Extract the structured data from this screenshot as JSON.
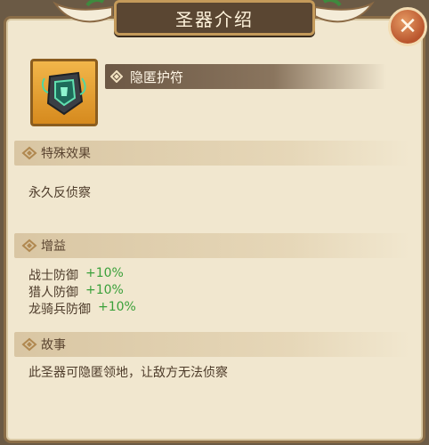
{
  "header": {
    "title": "圣器介绍",
    "close_glyph": "✕"
  },
  "artifact": {
    "name": "隐匿护符",
    "icon": "amulet-icon"
  },
  "sections": {
    "effect": {
      "title": "特殊效果",
      "text": "永久反侦察"
    },
    "buff": {
      "title": "增益",
      "rows": [
        {
          "label": "战士防御",
          "value": "+10%"
        },
        {
          "label": "猎人防御",
          "value": "+10%"
        },
        {
          "label": "龙骑兵防御",
          "value": "+10%"
        }
      ]
    },
    "story": {
      "title": "故事",
      "text": "此圣器可隐匿领地，让敌方无法侦察"
    }
  },
  "colors": {
    "panel_bg": "#f1e7cf",
    "buff_value": "#3aa03a",
    "close_button": "#b9552d"
  }
}
